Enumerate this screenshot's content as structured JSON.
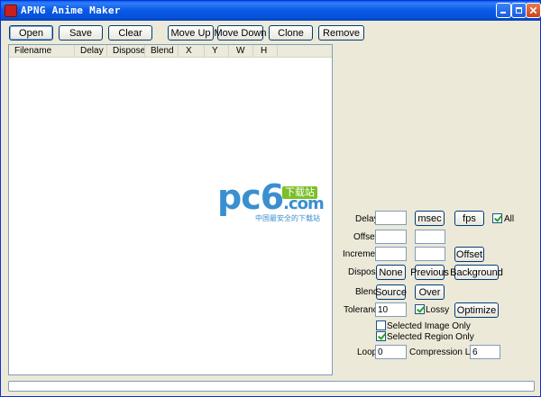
{
  "window": {
    "title": "APNG Anime Maker"
  },
  "toolbar": {
    "open": "Open",
    "save": "Save",
    "clear": "Clear",
    "move_up": "Move Up",
    "move_down": "Move Down",
    "clone": "Clone",
    "remove": "Remove"
  },
  "list": {
    "columns": [
      "Filename",
      "Delay",
      "Dispose",
      "Blend",
      "X",
      "Y",
      "W",
      "H"
    ]
  },
  "watermark": {
    "main": "pc6",
    "badge": "下载站",
    "suffix": ".com",
    "sub": "中国最安全的下载站"
  },
  "settings": {
    "delay_label": "Delay",
    "delay_value": "",
    "msec_label": "msec",
    "fps_label": "fps",
    "all_label": "All",
    "all_checked": true,
    "offset_label": "Offset",
    "offset_x": "",
    "offset_y": "",
    "increment_label": "Increment",
    "increment_x": "",
    "increment_y": "",
    "offset_button": "Offset",
    "dispose_label": "Dispose",
    "none_button": "None",
    "previous_button": "Previous",
    "background_button": "Background",
    "blend_label": "Blend",
    "source_button": "Source",
    "over_button": "Over",
    "tolerance_label": "Tolerance",
    "tolerance_value": "10",
    "lossy_label": "Lossy",
    "lossy_checked": true,
    "optimize_button": "Optimize",
    "selected_image_label": "Selected Image Only",
    "selected_image_checked": false,
    "selected_region_label": "Selected Region Only",
    "selected_region_checked": true,
    "loop_label": "Loop",
    "loop_value": "0",
    "compression_label": "Compression Level",
    "compression_value": "6"
  },
  "colors": {
    "titlebar": "#0a5ae8",
    "window_bg": "#ece9d8",
    "watermark_blue": "#3a8fd0",
    "watermark_green": "#7cbf2a"
  }
}
